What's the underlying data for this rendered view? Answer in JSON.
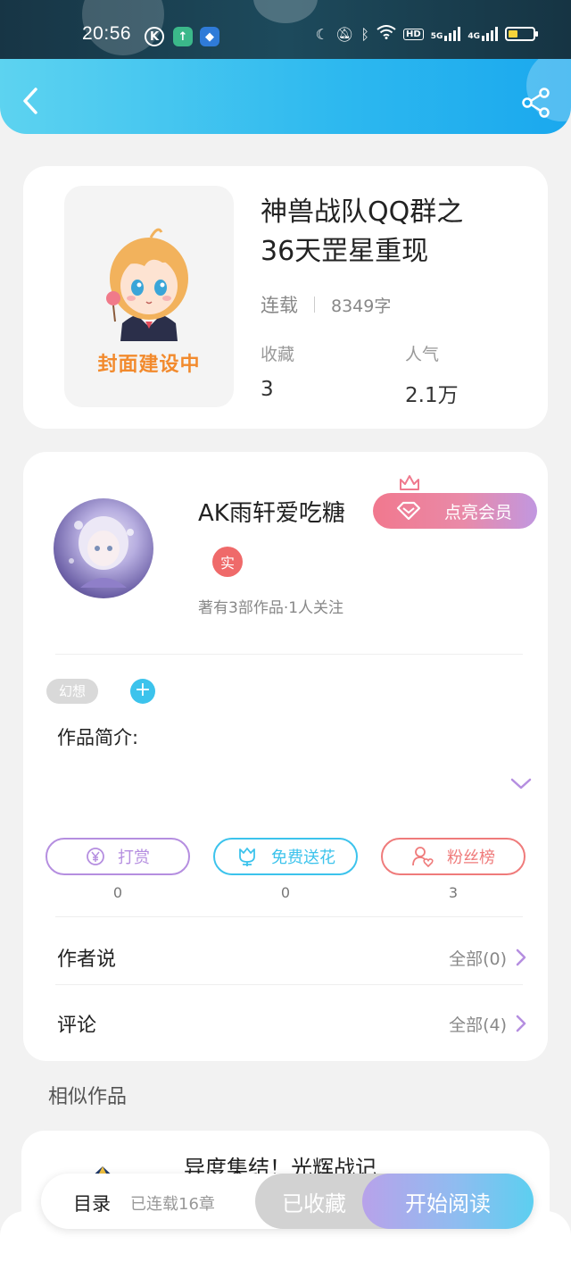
{
  "status_bar": {
    "time": "20:56",
    "app_icons": [
      "k-app-icon",
      "upload-app-icon",
      "android-app-icon"
    ],
    "indicators": [
      "moon-icon",
      "mute-bell-icon",
      "bluetooth-icon",
      "wifi-icon"
    ],
    "hd_label": "HD",
    "signal_labels": [
      "5G",
      "4G"
    ]
  },
  "header": {
    "back_icon": "back-arrow-icon",
    "share_icon": "share-icon"
  },
  "book": {
    "cover_text": "封面建设中",
    "title_line1": "神兽战队QQ群之",
    "title_line2": "36天罡星重现",
    "status": "连载",
    "word_count": "8349字",
    "favorites_label": "收藏",
    "favorites_value": "3",
    "popularity_label": "人气",
    "popularity_value": "2.1万"
  },
  "author": {
    "name": "AK雨轩爱吃糖",
    "vip_label": "点亮会员",
    "real_badge": "实",
    "stats": "著有3部作品·1人关注"
  },
  "tags": [
    "幻想"
  ],
  "intro_label": "作品简介:",
  "actions": [
    {
      "label": "打赏",
      "count": "0",
      "color": "#b58ee0"
    },
    {
      "label": "免费送花",
      "count": "0",
      "color": "#3cc3ec"
    },
    {
      "label": "粉丝榜",
      "count": "3",
      "color": "#ef7b7b"
    }
  ],
  "rows": {
    "author_says_label": "作者说",
    "author_says_value": "全部(0)",
    "comments_label": "评论",
    "comments_value": "全部(4)"
  },
  "similar": {
    "label": "相似作品",
    "first_title": "异度集结！光辉战记"
  },
  "bottom": {
    "toc": "目录",
    "serial": "已连载16章",
    "favorited": "已收藏",
    "start_reading": "开始阅读"
  },
  "colors": {
    "accent": "#2db8ef",
    "vip": "#e98aa8",
    "badge": "#ef6a6a"
  }
}
